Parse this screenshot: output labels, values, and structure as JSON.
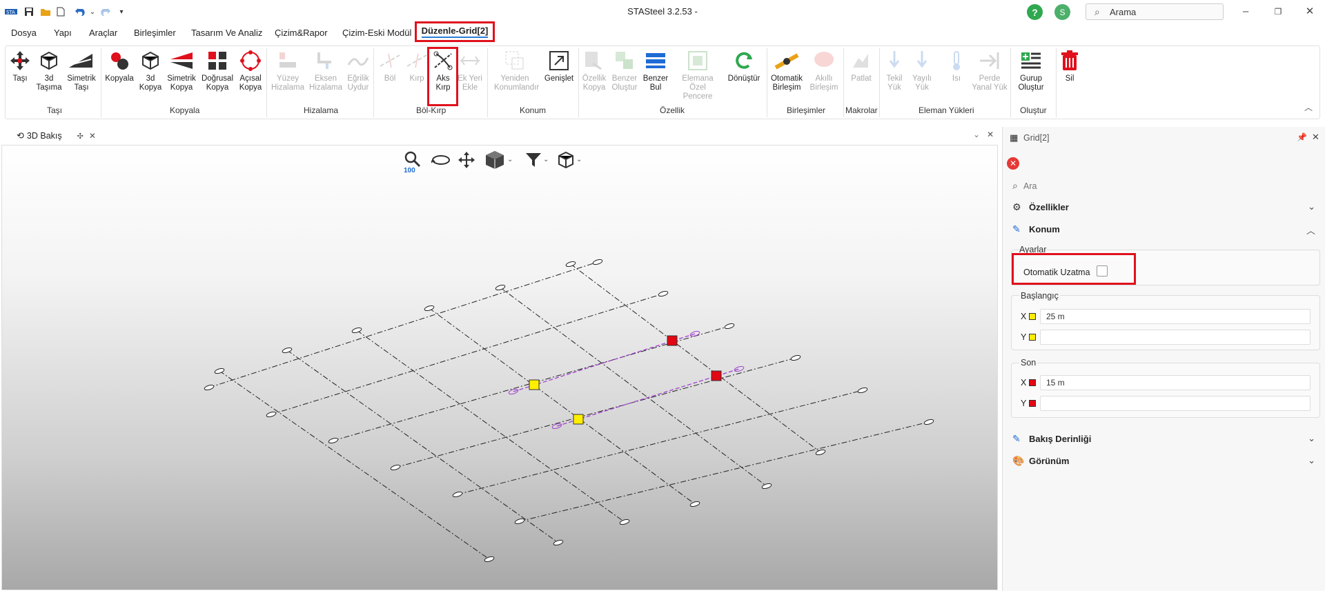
{
  "window": {
    "title": "STASteel 3.2.53 -",
    "search_label": "Arama",
    "user_initial": "S",
    "help_glyph": "?"
  },
  "menu": {
    "tabs": [
      "Dosya",
      "Yapı",
      "Araçlar",
      "Birleşimler",
      "Tasarım Ve Analiz",
      "Çizim&Rapor",
      "Çizim-Eski Modül"
    ],
    "active_tab": "Düzenle-Grid[2]"
  },
  "ribbon": {
    "buttons": [
      {
        "l1": "Taşı",
        "l2": "",
        "icon": "move-icon",
        "enabled": true
      },
      {
        "l1": "3d",
        "l2": "Taşıma",
        "icon": "3d-move-icon",
        "enabled": true
      },
      {
        "l1": "Simetrik",
        "l2": "Taşı",
        "icon": "mirror-move-icon",
        "enabled": true
      },
      {
        "l1": "Kopyala",
        "l2": "",
        "icon": "copy-icon",
        "enabled": true
      },
      {
        "l1": "3d",
        "l2": "Kopya",
        "icon": "3d-copy-icon",
        "enabled": true
      },
      {
        "l1": "Simetrik",
        "l2": "Kopya",
        "icon": "mirror-copy-icon",
        "enabled": true
      },
      {
        "l1": "Doğrusal",
        "l2": "Kopya",
        "icon": "linear-copy-icon",
        "enabled": true
      },
      {
        "l1": "Açısal",
        "l2": "Kopya",
        "icon": "angular-copy-icon",
        "enabled": true
      },
      {
        "l1": "Yüzey",
        "l2": "Hizalama",
        "icon": "surface-align-icon",
        "enabled": false
      },
      {
        "l1": "Eksen",
        "l2": "Hizalama",
        "icon": "axis-align-icon",
        "enabled": false
      },
      {
        "l1": "Eğrilik",
        "l2": "Uydur",
        "icon": "curve-fit-icon",
        "enabled": false
      },
      {
        "l1": "Böl",
        "l2": "",
        "icon": "split-icon",
        "enabled": false
      },
      {
        "l1": "Kırp",
        "l2": "",
        "icon": "trim-icon",
        "enabled": false
      },
      {
        "l1": "Aks",
        "l2": "Kırp",
        "icon": "axis-trim-icon",
        "enabled": true
      },
      {
        "l1": "Ek Yeri",
        "l2": "Ekle",
        "icon": "splice-icon",
        "enabled": false
      },
      {
        "l1": "Yeniden",
        "l2": "Konumlandır",
        "icon": "reposition-icon",
        "enabled": false
      },
      {
        "l1": "Genişlet",
        "l2": "",
        "icon": "extend-icon",
        "enabled": true
      },
      {
        "l1": "Özellik",
        "l2": "Kopya",
        "icon": "property-copy-icon",
        "enabled": false
      },
      {
        "l1": "Benzer",
        "l2": "Oluştur",
        "icon": "create-similar-icon",
        "enabled": false
      },
      {
        "l1": "Benzer",
        "l2": "Bul",
        "icon": "find-similar-icon",
        "enabled": true
      },
      {
        "l1": "Elemana Özel",
        "l2": "Pencere",
        "icon": "member-window-icon",
        "enabled": false
      },
      {
        "l1": "Dönüştür",
        "l2": "",
        "icon": "convert-icon",
        "enabled": true
      },
      {
        "l1": "Otomatik",
        "l2": "Birleşim",
        "icon": "auto-connection-icon",
        "enabled": true
      },
      {
        "l1": "Akıllı",
        "l2": "Birleşim",
        "icon": "smart-connection-icon",
        "enabled": false
      },
      {
        "l1": "Patlat",
        "l2": "",
        "icon": "explode-icon",
        "enabled": false
      },
      {
        "l1": "Tekil",
        "l2": "Yük",
        "icon": "point-load-icon",
        "enabled": false
      },
      {
        "l1": "Yayılı",
        "l2": "Yük",
        "icon": "distributed-load-icon",
        "enabled": false
      },
      {
        "l1": "Isı",
        "l2": "",
        "icon": "thermometer-icon",
        "enabled": false
      },
      {
        "l1": "Perde",
        "l2": "Yanal Yük",
        "icon": "wall-lateral-load-icon",
        "enabled": false
      },
      {
        "l1": "Gurup",
        "l2": "Oluştur",
        "icon": "group-create-icon",
        "enabled": true
      },
      {
        "l1": "Sil",
        "l2": "",
        "icon": "delete-icon",
        "enabled": true
      }
    ],
    "groups": [
      "Taşı",
      "Kopyala",
      "Hizalama",
      "Böl-Kırp",
      "Konum",
      "Özellik",
      "Birleşimler",
      "Makrolar",
      "Eleman Yükleri",
      "Oluştur"
    ]
  },
  "view": {
    "tab_label": "3D Bakış",
    "zoom_label": "100"
  },
  "panel": {
    "title": "Grid[2]",
    "search_placeholder": "Ara",
    "sections": {
      "ozellikler": "Özellikler",
      "konum": "Konum",
      "bakis": "Bakış Derinliği",
      "gorunum": "Görünüm"
    },
    "ayarlar": "Ayarlar",
    "otomatik_uzatma": "Otomatik Uzatma",
    "otomatik_uzatma_checked": false,
    "baslangic": {
      "title": "Başlangıç",
      "x_label": "X",
      "x_value": "25 m",
      "y_label": "Y",
      "y_value": ""
    },
    "son": {
      "title": "Son",
      "x_label": "X",
      "x_value": "15 m",
      "y_label": "Y",
      "y_value": ""
    }
  },
  "colors": {
    "accent_red": "#e0101c",
    "start_marker": "#ffee00",
    "end_marker": "#e30613",
    "selected_axis": "#a040d0"
  }
}
